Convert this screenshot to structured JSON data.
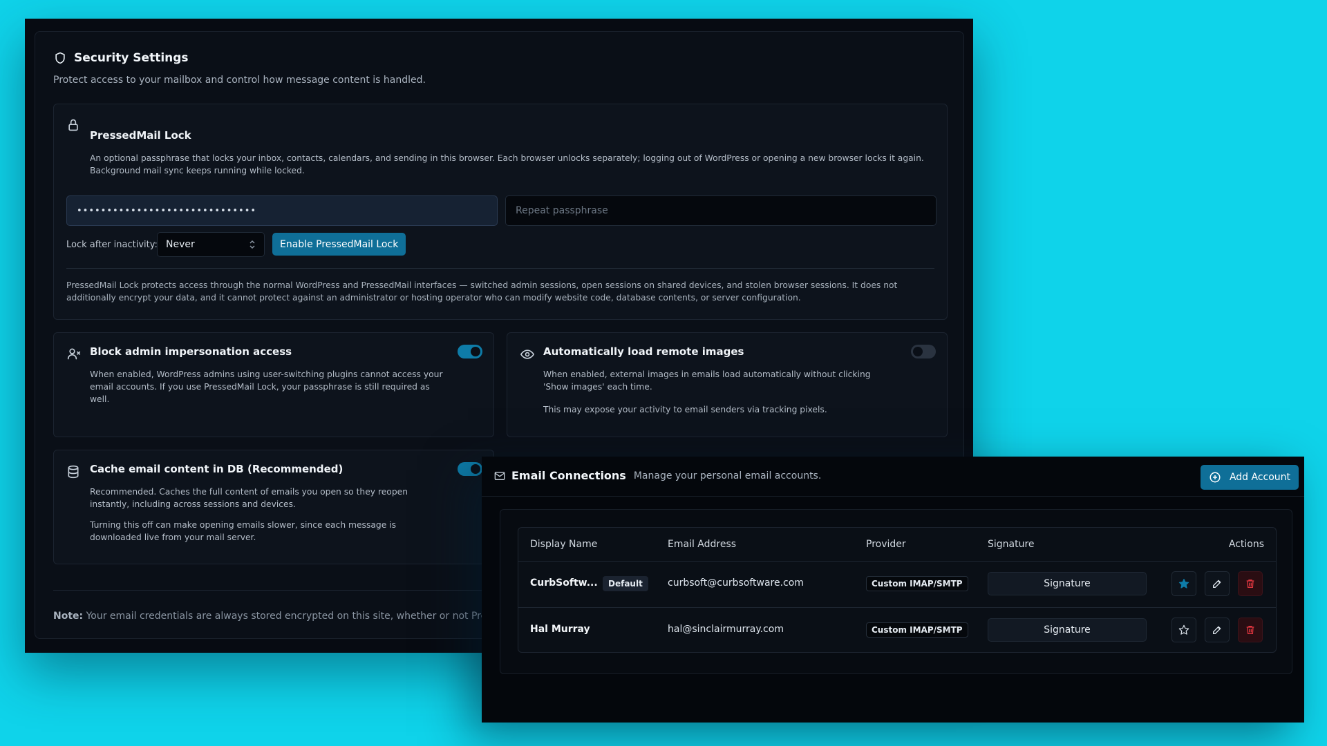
{
  "colors": {
    "background": "#0fd3ea",
    "accent": "#0f6f98",
    "danger": "#e0363f"
  },
  "security": {
    "title": "Security Settings",
    "subtitle": "Protect access to your mailbox and control how message content is handled.",
    "lock": {
      "title": "PressedMail Lock",
      "description": "An optional passphrase that locks your inbox, contacts, calendars, and sending in this browser. Each browser unlocks separately; logging out of WordPress or opening a new browser locks it again. Background mail sync keeps running while locked.",
      "passphrase_value": "••••••••••••••••••••••••••••••",
      "repeat_placeholder": "Repeat passphrase",
      "inactivity_label": "Lock after inactivity:",
      "inactivity_value": "Never",
      "enable_button": "Enable PressedMail Lock",
      "disclaimer": "PressedMail Lock protects access through the normal WordPress and PressedMail interfaces — switched admin sessions, open sessions on shared devices, and stolen browser sessions. It does not additionally encrypt your data, and it cannot protect against an administrator or hosting operator who can modify website code, database contents, or server configuration."
    },
    "block_admin": {
      "title": "Block admin impersonation access",
      "description": "When enabled, WordPress admins using user-switching plugins cannot access your email accounts. If you use PressedMail Lock, your passphrase is still required as well.",
      "enabled": true
    },
    "remote_images": {
      "title": "Automatically load remote images",
      "description": "When enabled, external images in emails load automatically without clicking 'Show images' each time.",
      "warning": "This may expose your activity to email senders via tracking pixels.",
      "enabled": false
    },
    "cache": {
      "title": "Cache email content in DB (Recommended)",
      "description": "Recommended. Caches the full content of emails you open so they reopen instantly, including across sessions and devices.",
      "warning": "Turning this off can make opening emails slower, since each message is downloaded live from your mail server.",
      "enabled": true
    },
    "note_label": "Note:",
    "note_text": " Your email credentials are always stored encrypted on this site, whether or not Press"
  },
  "email_connections": {
    "title": "Email Connections",
    "subtitle": "Manage your personal email accounts.",
    "add_button": "Add Account",
    "columns": [
      "Display Name",
      "Email Address",
      "Provider",
      "Signature",
      "Actions"
    ],
    "rows": [
      {
        "display_name": "CurbSoftw...",
        "badge": "Default",
        "email": "curbsoft@curbsoftware.com",
        "provider": "Custom IMAP/SMTP",
        "signature_label": "Signature",
        "is_default": true
      },
      {
        "display_name": "Hal Murray",
        "badge": "",
        "email": "hal@sinclairmurray.com",
        "provider": "Custom IMAP/SMTP",
        "signature_label": "Signature",
        "is_default": false
      }
    ]
  }
}
